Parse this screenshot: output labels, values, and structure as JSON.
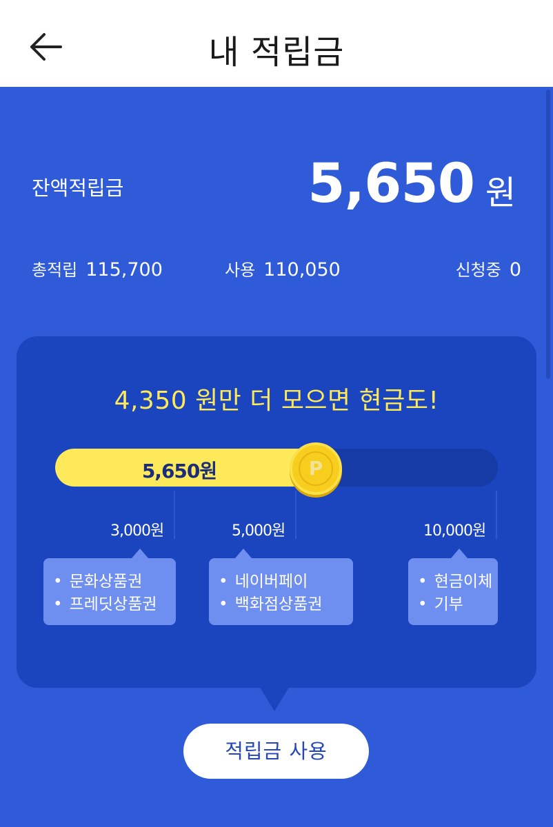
{
  "header": {
    "title": "내 적립금",
    "back_icon": "arrow-left-icon"
  },
  "balance": {
    "label": "잔액적립금",
    "amount": "5,650",
    "unit": "원"
  },
  "stats": {
    "total": {
      "label": "총적립",
      "value": "115,700"
    },
    "used": {
      "label": "사용",
      "value": "110,050"
    },
    "pending": {
      "label": "신청중",
      "value": "0"
    }
  },
  "progress": {
    "headline": "4,350 원만 더 모으면 현금도!",
    "current_label": "5,650원",
    "current_value": 5650,
    "max_value": 10000,
    "coin_icon": "point-coin-icon",
    "milestones": [
      {
        "label": "3,000원",
        "value": 3000,
        "rewards": [
          "문화상품권",
          "프레딧상품권"
        ]
      },
      {
        "label": "5,000원",
        "value": 5000,
        "rewards": [
          "네이버페이",
          "백화점상품권"
        ]
      },
      {
        "label": "10,000원",
        "value": 10000,
        "rewards": [
          "현금이체",
          "기부"
        ]
      }
    ]
  },
  "actions": {
    "use_button": "적립금 사용"
  },
  "colors": {
    "background": "#2f5ad8",
    "card": "#1b44bf",
    "accent_yellow": "#fde95a",
    "bubble": "#6f8ff0",
    "button_text": "#2547b8"
  }
}
